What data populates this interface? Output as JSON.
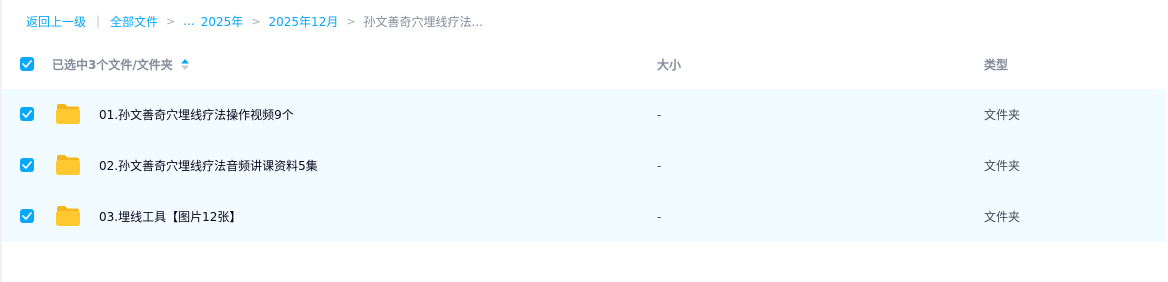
{
  "breadcrumb": {
    "back": "返回上一级",
    "separator": "|",
    "root": "全部文件",
    "ellipsis": "...",
    "year": "2025年",
    "month": "2025年12月",
    "current": "孙文善奇穴埋线疗法..."
  },
  "header": {
    "name_label": "已选中3个文件/文件夹",
    "size_label": "大小",
    "type_label": "类型",
    "select_all_checked": true
  },
  "rows": [
    {
      "name": "01.孙文善奇穴埋线疗法操作视频9个",
      "size": "-",
      "type": "文件夹",
      "checked": true
    },
    {
      "name": "02.孙文善奇穴埋线疗法音频讲课资料5集",
      "size": "-",
      "type": "文件夹",
      "checked": true
    },
    {
      "name": "03.埋线工具【图片12张】",
      "size": "-",
      "type": "文件夹",
      "checked": true
    }
  ],
  "colors": {
    "accent": "#06a7ff",
    "row_selected_bg": "#f2fbff",
    "folder_yellow": "#ffc830"
  }
}
